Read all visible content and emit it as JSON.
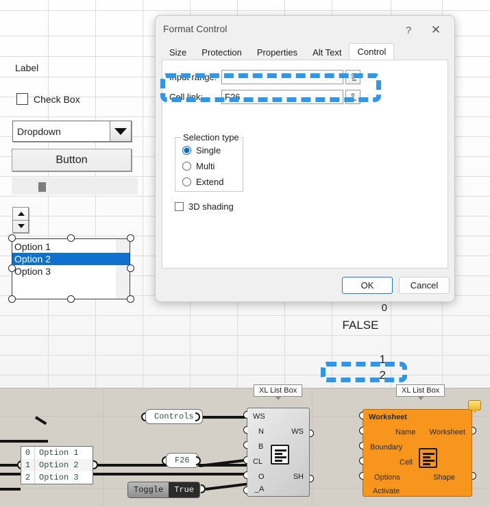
{
  "sheet": {
    "label_text": "Label",
    "checkbox_label": "Check Box",
    "dropdown_value": "Dropdown",
    "button_label": "Button",
    "listbox_items": [
      {
        "text": "Option 1",
        "selected": false
      },
      {
        "text": "Option 2",
        "selected": true
      },
      {
        "text": "Option 3",
        "selected": false
      }
    ],
    "cells": {
      "linked_index": "0",
      "checkbox_value": "FALSE",
      "value_1": "1",
      "value_2": "2"
    }
  },
  "dialog": {
    "title": "Format Control",
    "help_icon": "?",
    "close_icon": "✕",
    "tabs": [
      {
        "label": "Size",
        "active": false
      },
      {
        "label": "Protection",
        "active": false
      },
      {
        "label": "Properties",
        "active": false
      },
      {
        "label": "Alt Text",
        "active": false
      },
      {
        "label": "Control",
        "active": true
      }
    ],
    "input_range": {
      "label": "Input range:",
      "underline": "I",
      "value": "",
      "placeholder": "",
      "picker_icon": "range-picker-icon"
    },
    "cell_link": {
      "label": "Cell link:",
      "underline": "C",
      "value": "F26",
      "placeholder": "",
      "picker_icon": "range-picker-icon"
    },
    "selection_type": {
      "caption": "Selection type",
      "options": [
        {
          "label": "Single",
          "mnemonic": "S",
          "checked": true
        },
        {
          "label": "Multi",
          "mnemonic": "M",
          "checked": false
        },
        {
          "label": "Extend",
          "mnemonic": "E",
          "checked": false
        }
      ]
    },
    "shading_3d": {
      "label": "3D shading",
      "checked": false
    },
    "ok_label": "OK",
    "cancel_label": "Cancel"
  },
  "annotations": {
    "accent_color": "#2e97e8",
    "cell_link_highlight": "Cell link: F26",
    "cells_highlight": "1 / 2"
  },
  "diagram": {
    "labels": {
      "node1": "XL List Box",
      "node2": "XL List Box"
    },
    "constants": {
      "controls": "Controls",
      "cell_ref": "F26"
    },
    "array_constant": {
      "rows": [
        {
          "index": "0",
          "value": "Option 1"
        },
        {
          "index": "1",
          "value": "Option 2"
        },
        {
          "index": "2",
          "value": "Option 3"
        }
      ]
    },
    "boolean_constant": {
      "name": "Toggle",
      "value": "True"
    },
    "node_listbox": {
      "inputs": [
        "WS",
        "N",
        "B",
        "CL",
        "O",
        "_A"
      ],
      "outputs": [
        "WS",
        "SH"
      ]
    },
    "node_worksheet": {
      "title": "Worksheet",
      "inputs": [
        "Name",
        "Boundary",
        "Cell",
        "Options",
        "Activate"
      ],
      "outputs": [
        "Worksheet",
        "Shape"
      ]
    }
  }
}
